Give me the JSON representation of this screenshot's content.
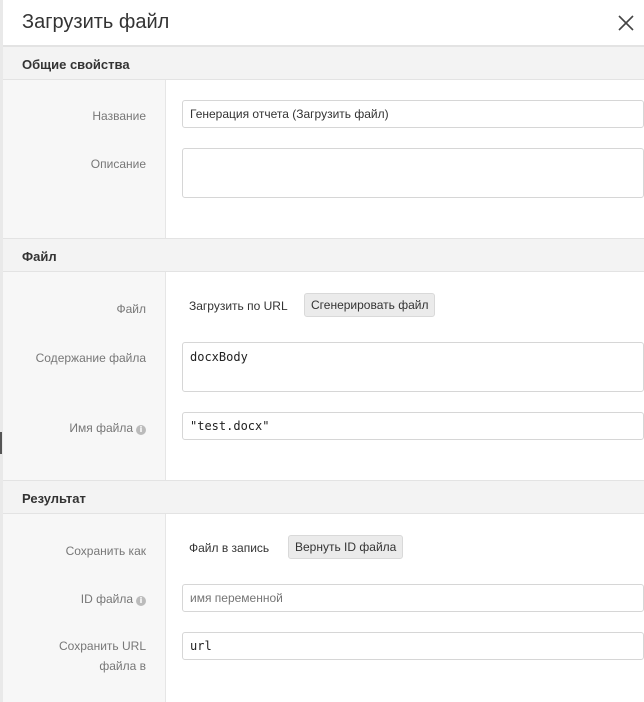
{
  "dialog": {
    "title": "Загрузить файл"
  },
  "sections": {
    "general": {
      "title": "Общие свойства",
      "name_label": "Название",
      "name_value": "Генерация отчета (Загрузить файл)",
      "description_label": "Описание",
      "description_value": ""
    },
    "file": {
      "title": "Файл",
      "file_label": "Файл",
      "option_url": "Загрузить по URL",
      "option_generate": "Сгенерировать файл",
      "content_label": "Содержание файла",
      "content_value": "docxBody",
      "filename_label": "Имя файла",
      "filename_value": "\"test.docx\""
    },
    "result": {
      "title": "Результат",
      "save_as_label": "Сохранить как",
      "option_record": "Файл в запись",
      "option_return_id": "Вернуть ID файла",
      "file_id_label": "ID файла",
      "file_id_placeholder": "имя переменной",
      "save_url_label": "Сохранить URL файла в",
      "save_url_value": "url"
    }
  },
  "icons": {
    "close": "close-icon",
    "info": "info-icon"
  }
}
